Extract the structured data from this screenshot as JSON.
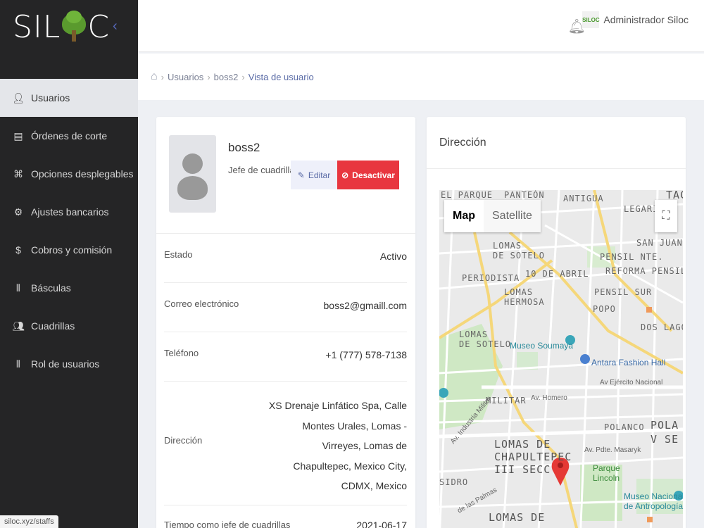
{
  "app": {
    "logo_text_left": "SIL",
    "logo_text_right": "C"
  },
  "sidebar": {
    "items": [
      {
        "label": "Usuarios",
        "icon": "user-icon"
      },
      {
        "label": "Órdenes de corte",
        "icon": "server-icon"
      },
      {
        "label": "Opciones desplegables",
        "icon": "command-icon"
      },
      {
        "label": "Ajustes bancarios",
        "icon": "gear-icon"
      },
      {
        "label": "Cobros y comisión",
        "icon": "invoice-icon"
      },
      {
        "label": "Básculas",
        "icon": "library-icon"
      },
      {
        "label": "Cuadrillas",
        "icon": "users-icon"
      },
      {
        "label": "Rol de usuarios",
        "icon": "library-icon"
      }
    ]
  },
  "header": {
    "user_name": "Administrador Siloc",
    "avatar_text": "SILOC"
  },
  "breadcrumb": {
    "items": [
      "Usuarios",
      "boss2"
    ],
    "current": "Vista de usuario"
  },
  "profile": {
    "name": "boss2",
    "role": "Jefe de cuadrilla",
    "edit_label": "Editar",
    "deactivate_label": "Desactivar",
    "fields": [
      {
        "label": "Estado",
        "value": "Activo"
      },
      {
        "label": "Correo electrónico",
        "value": "boss2@gmaill.com"
      },
      {
        "label": "Teléfono",
        "value": "+1 (777) 578-7138"
      },
      {
        "label": "Dirección",
        "value": "XS Drenaje Linfático Spa, Calle Montes Urales, Lomas - Virreyes, Lomas de Chapultepec, Mexico City, CDMX, Mexico"
      },
      {
        "label": "Tiempo como jefe de cuadrillas",
        "value": "2021-06-17"
      }
    ]
  },
  "address_card": {
    "title": "Dirección",
    "map_button": "Map",
    "satellite_button": "Satellite",
    "labels": {
      "el_parque": "EL PARQUE",
      "panteon": "PANTEÓN",
      "antigua": "ANTIGUA",
      "legaria": "LEGARIA",
      "lomas_sotelo": "LOMAS\nDE SOTELO",
      "san_juanico": "SAN JUANIC",
      "pensil_nte": "PENSIL NTE.",
      "periodista": "PERIODISTA",
      "abril": "10 DE ABRIL",
      "reforma_pensil": "REFORMA PENSIL",
      "lomas_hermosa": "LOMAS\nHERMOSA",
      "pensil_sur": "PENSIL SUR",
      "popo": "POPO",
      "dos_lagos": "DOS LAGOS",
      "lomas_sotelo2": "LOMAS\nDE SOTELO",
      "museo_soumaya": "Museo Soumaya",
      "antara": "Antara Fashion Hall",
      "ejercito": "Av Ejército Nacional",
      "homero": "Av. Homero",
      "militar": "MILITAR",
      "industria": "Av. Industria Militar",
      "polanco": "POLANCO",
      "polanco_v": "POLA\nV SE",
      "masaryk": "Av. Pdte. Masaryk",
      "lomas_chap": "LOMAS DE\nCHAPULTEPEC\nIII SECC",
      "parque_lincoln": "Parque\nLincoln",
      "museo_antropologia": "Museo Nacional\nde Antropología",
      "sidro": "SIDRO",
      "palmas": "de las Palmas",
      "lomas_de": "LOMAS DE",
      "tac": "TAC"
    }
  },
  "statusbar": {
    "url": "siloc.xyz/staffs"
  },
  "colors": {
    "danger": "#e8363f",
    "accent": "#5a6ba6",
    "sidebar_bg": "#252526"
  }
}
